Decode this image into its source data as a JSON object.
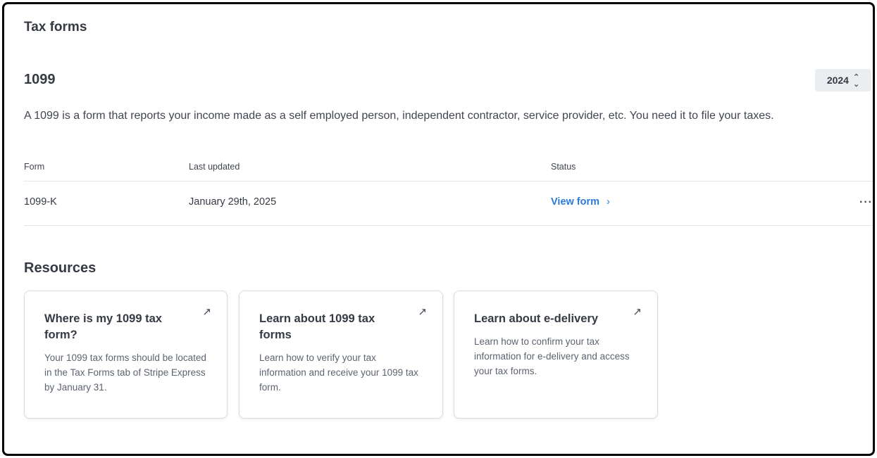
{
  "page": {
    "title": "Tax forms"
  },
  "section": {
    "title": "1099",
    "year_selected": "2024",
    "description": "A 1099 is a form that reports your income made as a self employed person, independent contractor, service provider, etc. You need it to file your taxes."
  },
  "table": {
    "columns": [
      "Form",
      "Last updated",
      "Status"
    ],
    "rows": [
      {
        "form": "1099-K",
        "last_updated": "January 29th, 2025",
        "status_link": "View form",
        "status_arrow": "›",
        "more": "···"
      }
    ]
  },
  "resources": {
    "title": "Resources",
    "cards": [
      {
        "title": "Where is my 1099 tax form?",
        "body": "Your 1099 tax forms should be located in the Tax Forms tab of Stripe Express by January 31.",
        "icon": "external-arrow-icon"
      },
      {
        "title": "Learn about 1099 tax forms",
        "body": "Learn how to verify your tax information and receive your 1099 tax form.",
        "icon": "external-arrow-icon"
      },
      {
        "title": "Learn about e-delivery",
        "body": "Learn how to confirm your tax information for e-delivery and access your tax forms.",
        "icon": "external-arrow-icon"
      }
    ]
  },
  "colors": {
    "link": "#2b7bd4",
    "text": "#353a44",
    "border": "#d5dbe1",
    "select_bg": "#ebeef1"
  }
}
